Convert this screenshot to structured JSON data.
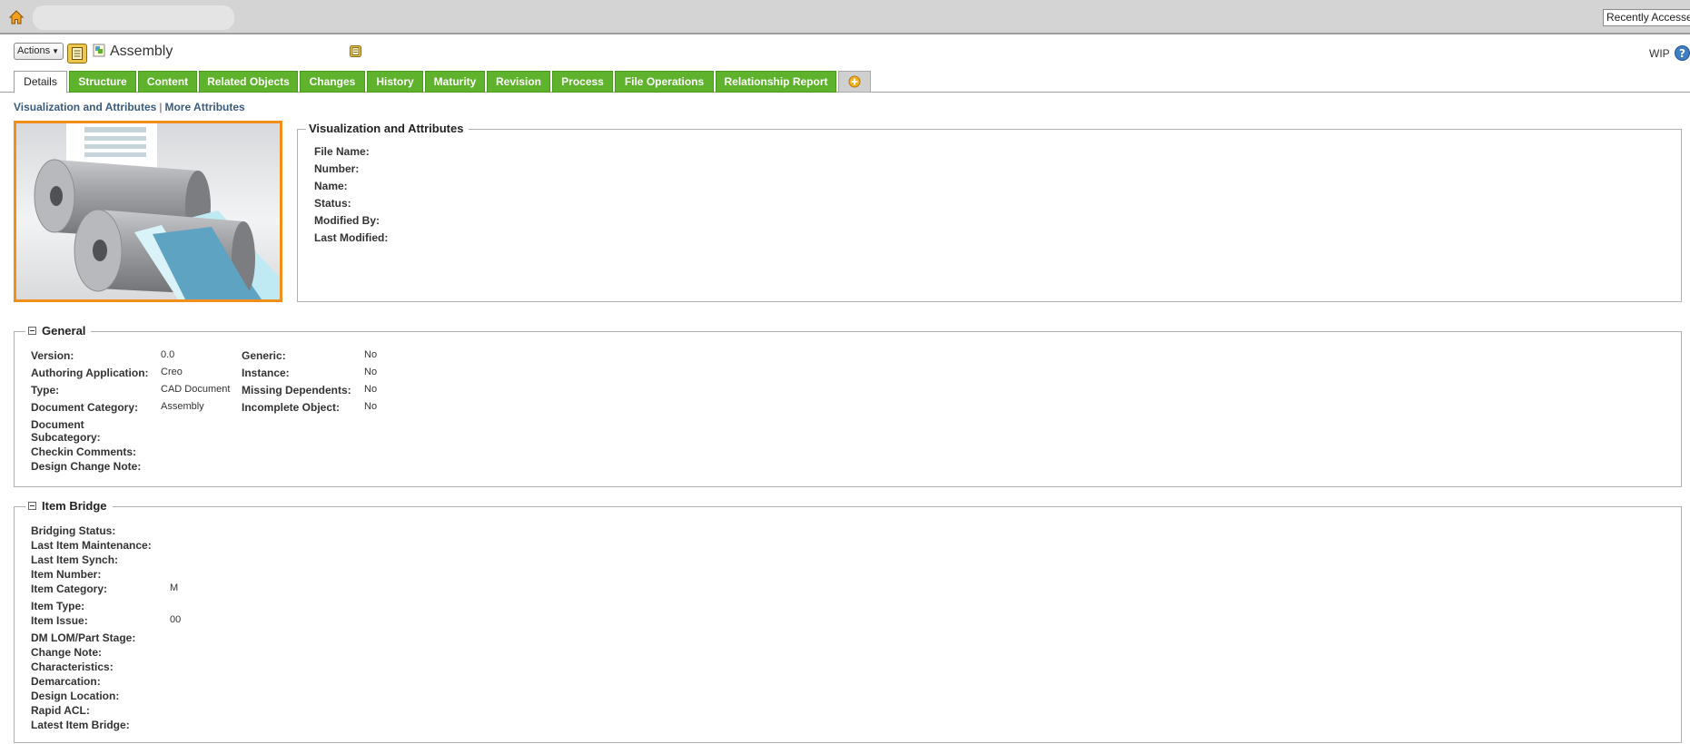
{
  "topbar": {
    "recently_accessed": "Recently Accessed"
  },
  "header": {
    "actions_label": "Actions",
    "title": "Assembly",
    "state": "WIP"
  },
  "tabs": [
    {
      "label": "Details"
    },
    {
      "label": "Structure"
    },
    {
      "label": "Content"
    },
    {
      "label": "Related Objects"
    },
    {
      "label": "Changes"
    },
    {
      "label": "History"
    },
    {
      "label": "Maturity"
    },
    {
      "label": "Revision"
    },
    {
      "label": "Process"
    },
    {
      "label": "File Operations"
    },
    {
      "label": "Relationship Report"
    }
  ],
  "subnav": {
    "visualization": "Visualization and Attributes",
    "more": "More Attributes",
    "separator": "|"
  },
  "visualization": {
    "title": "Visualization and Attributes",
    "labels": [
      "File Name:",
      "Number:",
      "Name:",
      "Status:",
      "Modified By:",
      "Last Modified:"
    ]
  },
  "general": {
    "title": "General",
    "left": [
      {
        "label": "Version:",
        "value": "0.0"
      },
      {
        "label": "Authoring Application:",
        "value": "Creo"
      },
      {
        "label": "Type:",
        "value": "CAD Document"
      },
      {
        "label": "Document Category:",
        "value": "Assembly"
      },
      {
        "label": "Document",
        "label2": "Subcategory:",
        "value": ""
      },
      {
        "label": "Checkin Comments:",
        "value": ""
      },
      {
        "label": "Design Change Note:",
        "value": ""
      }
    ],
    "right": [
      {
        "label": "Generic:",
        "value": "No"
      },
      {
        "label": "Instance:",
        "value": "No"
      },
      {
        "label": "Missing Dependents:",
        "value": "No"
      },
      {
        "label": "Incomplete Object:",
        "value": "No"
      }
    ]
  },
  "item_bridge": {
    "title": "Item Bridge",
    "rows": [
      {
        "label": "Bridging Status:",
        "value": ""
      },
      {
        "label": "Last Item Maintenance:",
        "value": ""
      },
      {
        "label": "Last Item Synch:",
        "value": ""
      },
      {
        "label": "Item Number:",
        "value": ""
      },
      {
        "label": "Item Category:",
        "value": "M"
      },
      {
        "label": "Item Type:",
        "value": ""
      },
      {
        "label": "Item Issue:",
        "value": "00"
      },
      {
        "label": "DM LOM/Part Stage:",
        "value": ""
      },
      {
        "label": "Change Note:",
        "value": ""
      },
      {
        "label": "Characteristics:",
        "value": ""
      },
      {
        "label": "Demarcation:",
        "value": ""
      },
      {
        "label": "Design Location:",
        "value": ""
      },
      {
        "label": "Rapid ACL:",
        "value": ""
      },
      {
        "label": "Latest Item Bridge:",
        "value": ""
      }
    ]
  },
  "colors": {
    "tab_green": "#5eb22c",
    "thumbnail_border": "#f0901a",
    "link": "#3a5b7c"
  },
  "icons": [
    "home-icon",
    "document-icon",
    "assembly-icon",
    "help-icon",
    "add-tab-icon",
    "collapse-icon"
  ]
}
